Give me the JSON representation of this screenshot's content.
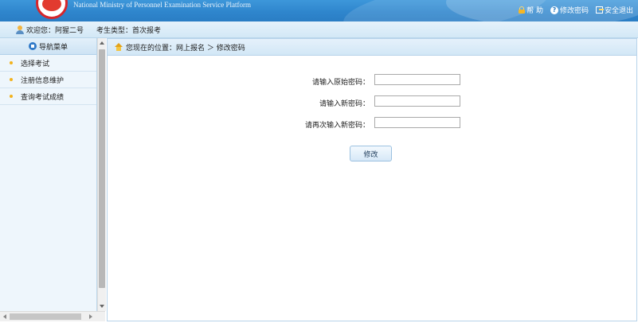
{
  "header": {
    "subtitle": "National Ministry of Personnel Examination Service Platform",
    "links": [
      {
        "label": "帮 助",
        "icon": "lock-icon"
      },
      {
        "label": "修改密码",
        "icon": "question-icon"
      },
      {
        "label": "安全退出",
        "icon": "exit-icon"
      }
    ]
  },
  "user": {
    "welcome": "欢迎您：阿猩二号",
    "exam_type": "考生类型：首次报考"
  },
  "sidebar": {
    "title": "导航菜单",
    "items": [
      {
        "label": "选择考试"
      },
      {
        "label": "注册信息维护"
      },
      {
        "label": "查询考试成绩"
      }
    ]
  },
  "breadcrumb": {
    "text": "您现在的位置：网上报名 ＞ 修改密码"
  },
  "form": {
    "old_password_label": "请输入原始密码：",
    "new_password_label": "请输入新密码：",
    "confirm_password_label": "请再次输入新密码：",
    "submit_label": "修改"
  },
  "colors": {
    "banner": "#2f86cd",
    "accent_bullet": "#f2b21c"
  }
}
